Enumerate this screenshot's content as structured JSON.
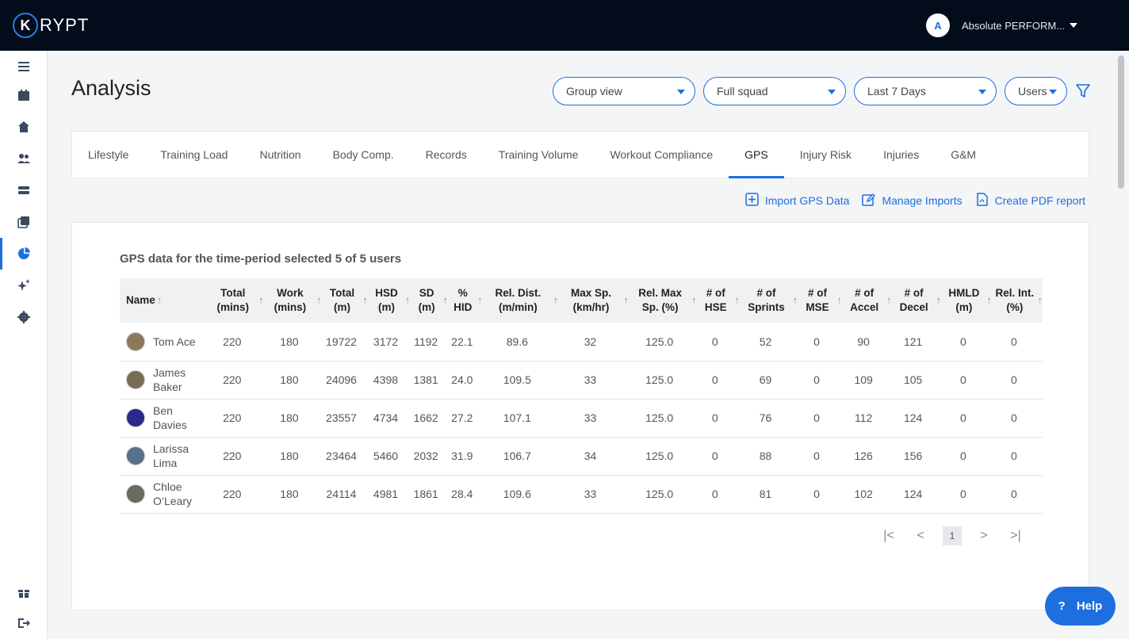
{
  "brand": {
    "logo_letter": "K",
    "name": "RYPT"
  },
  "org": {
    "avatar_text": "A",
    "name": "Absolute PERFORM..."
  },
  "sidebar": [
    {
      "icon": "menu-icon"
    },
    {
      "icon": "calendar-icon"
    },
    {
      "icon": "home-icon"
    },
    {
      "icon": "users-icon"
    },
    {
      "icon": "database-icon"
    },
    {
      "icon": "media-icon"
    },
    {
      "icon": "pie-chart-icon"
    },
    {
      "icon": "sparkle-icon"
    },
    {
      "icon": "settings-icon"
    },
    {
      "icon": "gift-icon"
    },
    {
      "icon": "logout-icon"
    }
  ],
  "page": {
    "title": "Analysis"
  },
  "filters": {
    "view": "Group view",
    "squad": "Full squad",
    "period": "Last 7 Days",
    "users": "Users"
  },
  "tabs": [
    "Lifestyle",
    "Training Load",
    "Nutrition",
    "Body Comp.",
    "Records",
    "Training Volume",
    "Workout Compliance",
    "GPS",
    "Injury Risk",
    "Injuries",
    "G&M"
  ],
  "active_tab": "GPS",
  "actions": {
    "import": "Import GPS Data",
    "manage": "Manage Imports",
    "pdf": "Create PDF report"
  },
  "card": {
    "title": "GPS data for the time-period selected 5 of 5 users"
  },
  "table": {
    "headers": [
      "Name",
      "Total (mins)",
      "Work (mins)",
      "Total (m)",
      "HSD (m)",
      "SD (m)",
      "% HID",
      "Rel. Dist. (m/min)",
      "Max Sp. (km/hr)",
      "Rel. Max Sp. (%)",
      "# of HSE",
      "# of Sprints",
      "# of MSE",
      "# of Accel",
      "# of Decel",
      "HMLD (m)",
      "Rel. Int. (%)"
    ],
    "rows": [
      {
        "name": "Tom Ace",
        "avatar": "#8a7a5a",
        "values": [
          "220",
          "180",
          "19722",
          "3172",
          "1192",
          "22.1",
          "89.6",
          "32",
          "125.0",
          "0",
          "52",
          "0",
          "90",
          "121",
          "0",
          "0"
        ]
      },
      {
        "name": "James Baker",
        "avatar": "#7a6b55",
        "values": [
          "220",
          "180",
          "24096",
          "4398",
          "1381",
          "24.0",
          "109.5",
          "33",
          "125.0",
          "0",
          "69",
          "0",
          "109",
          "105",
          "0",
          "0"
        ]
      },
      {
        "name": "Ben Davies",
        "avatar": "#2a2a8a",
        "values": [
          "220",
          "180",
          "23557",
          "4734",
          "1662",
          "27.2",
          "107.1",
          "33",
          "125.0",
          "0",
          "76",
          "0",
          "112",
          "124",
          "0",
          "0"
        ]
      },
      {
        "name": "Larissa Lima",
        "avatar": "#5a6f88",
        "values": [
          "220",
          "180",
          "23464",
          "5460",
          "2032",
          "31.9",
          "106.7",
          "34",
          "125.0",
          "0",
          "88",
          "0",
          "126",
          "156",
          "0",
          "0"
        ]
      },
      {
        "name": "Chloe O’Leary",
        "avatar": "#6a6a62",
        "values": [
          "220",
          "180",
          "24114",
          "4981",
          "1861",
          "28.4",
          "109.6",
          "33",
          "125.0",
          "0",
          "81",
          "0",
          "102",
          "124",
          "0",
          "0"
        ]
      }
    ]
  },
  "pager": {
    "first": "|<",
    "prev": "<",
    "current": "1",
    "next": ">",
    "last": ">|"
  },
  "help": {
    "icon": "?",
    "label": "Help"
  },
  "colors": {
    "accent": "#1d6fe0",
    "topbar": "#020c1b"
  }
}
